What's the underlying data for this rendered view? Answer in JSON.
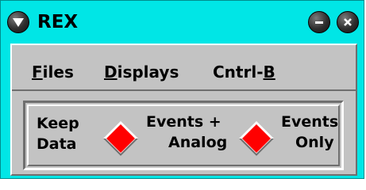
{
  "window": {
    "title": "REX"
  },
  "titlebar": {
    "menu_icon": "chevron-down-icon",
    "minimize_icon": "minimize-icon",
    "close_icon": "close-icon"
  },
  "menubar": {
    "files": {
      "mnemonic": "F",
      "rest": "iles"
    },
    "displays": {
      "mnemonic": "D",
      "rest": "isplays"
    },
    "cntrl": {
      "prefix": "Cntrl-",
      "mnemonic": "B"
    }
  },
  "options": {
    "keep_data": {
      "line1": "Keep",
      "line2": "Data"
    },
    "events_analog": {
      "line1": "Events +",
      "line2": "Analog"
    },
    "events_only": {
      "line1": "Events",
      "line2": "Only"
    }
  },
  "colors": {
    "window_bg": "#00e6e6",
    "panel_bg": "#c3c3c3",
    "radio_selected": "#ff0000"
  }
}
